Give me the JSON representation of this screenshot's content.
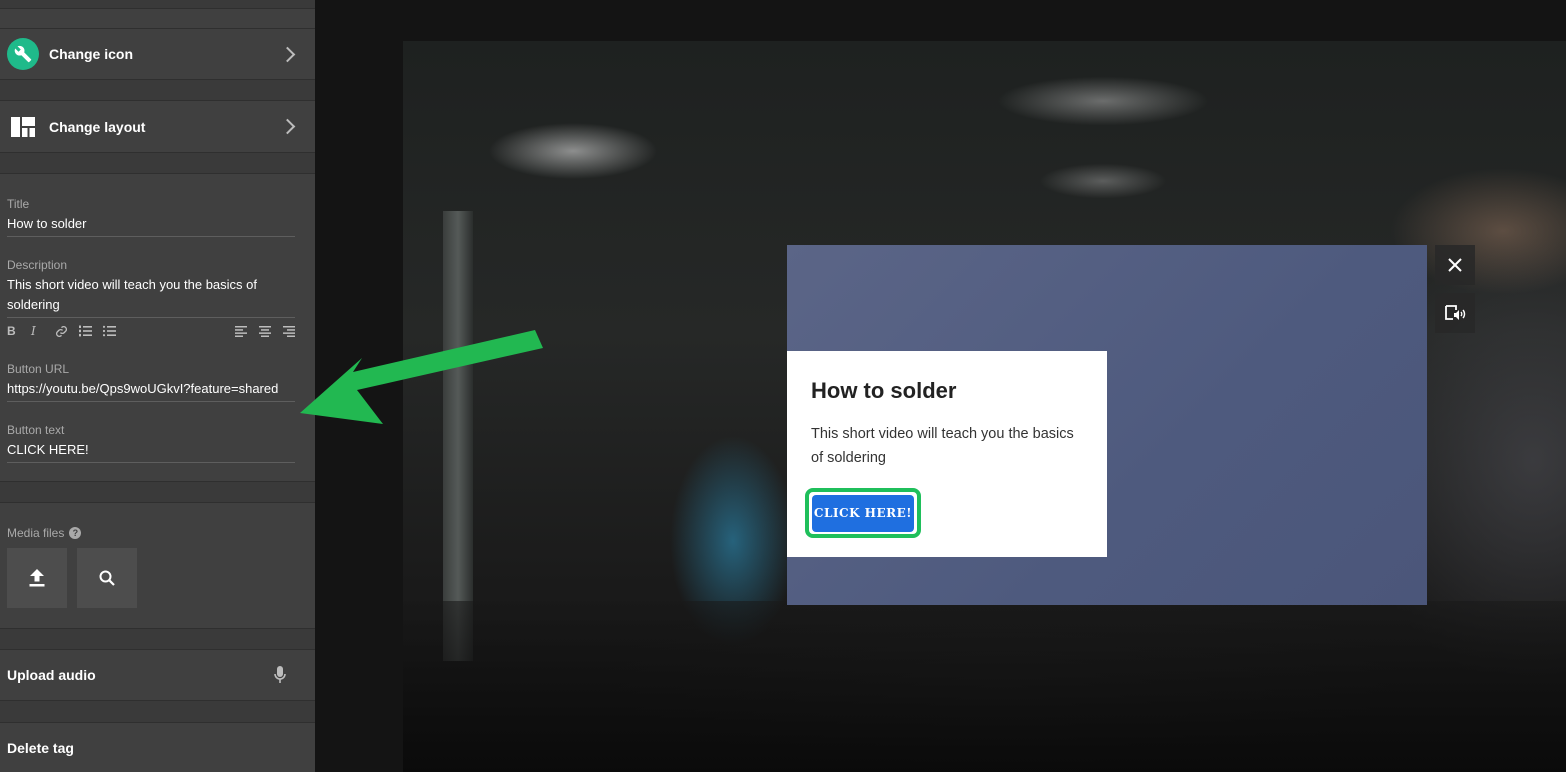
{
  "sidebar": {
    "change_icon_label": "Change icon",
    "change_layout_label": "Change layout",
    "title_label": "Title",
    "title_value": "How to solder",
    "description_label": "Description",
    "description_value": "This short video will teach you the basics of soldering",
    "toolbar": {
      "bold": "B",
      "italic": "I"
    },
    "button_url_label": "Button URL",
    "button_url_value": "https://youtu.be/Qps9woUGkvI?feature=shared",
    "button_text_label": "Button text",
    "button_text_value": "CLICK HERE!",
    "media_files_label": "Media files",
    "upload_audio_label": "Upload audio",
    "delete_tag_label": "Delete tag"
  },
  "popup": {
    "title": "How to solder",
    "description": "This short video will teach you the basics of soldering",
    "button_label": "CLICK HERE!"
  },
  "colors": {
    "accent_green": "#1fbf5b",
    "button_blue": "#1f6fe0",
    "icon_badge": "#1fba8a"
  }
}
